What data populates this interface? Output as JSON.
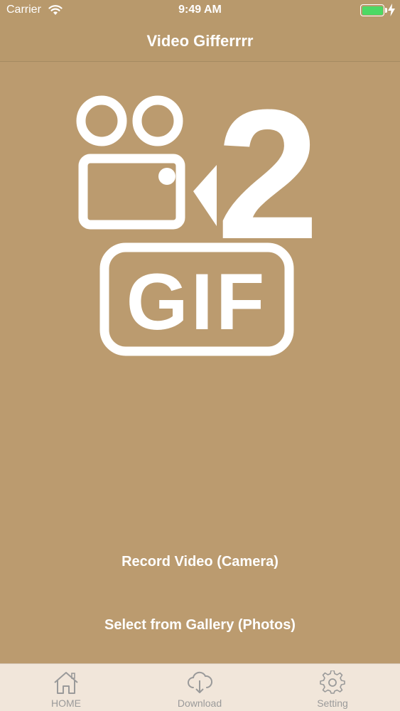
{
  "status_bar": {
    "carrier": "Carrier",
    "time": "9:49 AM",
    "battery_color": "#4cd964"
  },
  "nav": {
    "title": "Video Gifferrrr"
  },
  "logo": {
    "number": "2",
    "gif_text": "GIF",
    "icon": "video-camera-icon"
  },
  "actions": {
    "record_label": "Record Video (Camera)",
    "gallery_label": "Select from Gallery (Photos)"
  },
  "tabs": [
    {
      "label": "HOME",
      "icon": "home-icon"
    },
    {
      "label": "Download",
      "icon": "cloud-download-icon"
    },
    {
      "label": "Setting",
      "icon": "gear-icon"
    }
  ],
  "colors": {
    "background": "#bb9b6f",
    "tab_bar": "#f1e6da",
    "tab_inactive": "#9a9a9a"
  }
}
